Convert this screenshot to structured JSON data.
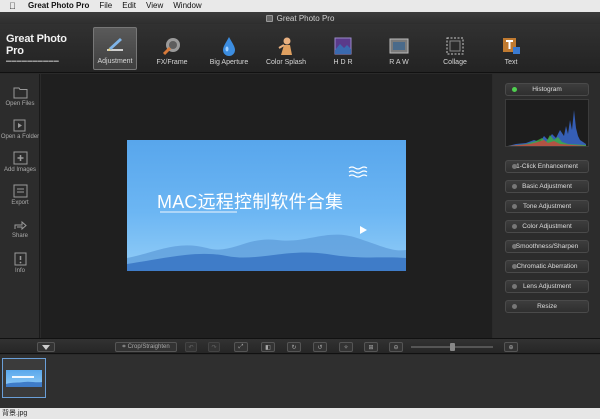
{
  "menubar": {
    "app_name": "Great Photo Pro",
    "items": [
      "File",
      "Edit",
      "View",
      "Window"
    ]
  },
  "window": {
    "title": "Great Photo Pro"
  },
  "brand": {
    "name": "Great Photo Pro"
  },
  "toolbar": {
    "tools": [
      {
        "label": "Adjustment",
        "icon": "pen-brush-icon",
        "active": true
      },
      {
        "label": "FX/Frame",
        "icon": "fx-frame-icon"
      },
      {
        "label": "Big Aperture",
        "icon": "water-drop-icon"
      },
      {
        "label": "Color Splash",
        "icon": "color-splash-icon"
      },
      {
        "label": "H D R",
        "icon": "hdr-icon"
      },
      {
        "label": "R A W",
        "icon": "raw-icon"
      },
      {
        "label": "Collage",
        "icon": "collage-icon"
      },
      {
        "label": "Text",
        "icon": "text-icon"
      }
    ]
  },
  "sidebar": {
    "items": [
      {
        "label": "Open Files",
        "icon": "folder-icon"
      },
      {
        "label": "Open a Folder",
        "icon": "open-folder-icon"
      },
      {
        "label": "Add Images",
        "icon": "add-image-icon"
      },
      {
        "label": "Export",
        "icon": "export-icon"
      },
      {
        "label": "Share",
        "icon": "share-icon"
      },
      {
        "label": "Info",
        "icon": "info-icon"
      }
    ]
  },
  "photo": {
    "title": "MAC远程控制软件合集"
  },
  "panel": {
    "histogram_label": "Histogram",
    "buttons": [
      "1-Click Enhancement",
      "Basic Adjustment",
      "Tone Adjustment",
      "Color Adjustment",
      "Smoothness/Sharpen",
      "Chromatic Aberration",
      "Lens Adjustment",
      "Resize"
    ]
  },
  "bottom": {
    "crop_label": "Crop/Straighten",
    "zoom_level": 0.5
  },
  "status": {
    "filename": "背景.jpg"
  },
  "colors": {
    "accent_green": "#4fd04f",
    "photo_blue": "#58a6ec"
  }
}
